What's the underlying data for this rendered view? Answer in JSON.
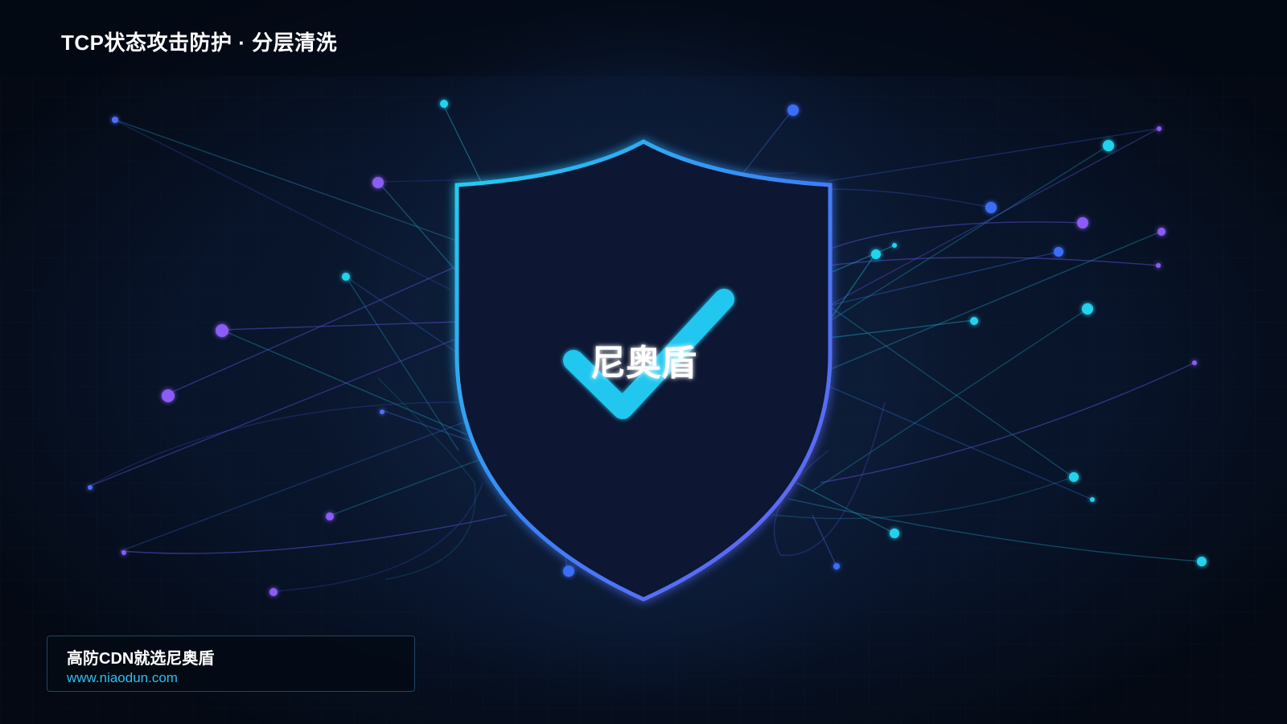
{
  "header": {
    "title": "TCP状态攻击防护 · 分层清洗"
  },
  "shield": {
    "label": "尼奥盾",
    "icon": "shield-check-icon"
  },
  "footer": {
    "tagline": "高防CDN就选尼奥盾",
    "url": "www.niaodun.com"
  },
  "colors": {
    "background": "#050b16",
    "panel": "#0b1830",
    "cyan": "#22d3ee",
    "blue": "#3b82f6",
    "violet": "#8b5cf6",
    "url_text": "#27c0ef"
  }
}
